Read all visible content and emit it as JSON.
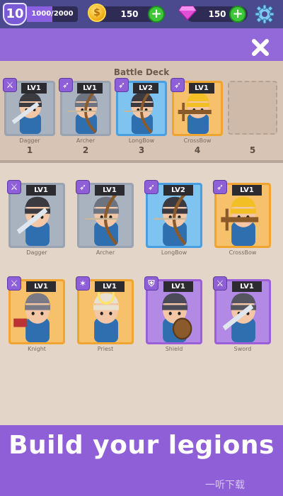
{
  "topbar": {
    "level": "10",
    "xp_text": "1000/2000",
    "xp_fraction": 0.5,
    "coins": "150",
    "gems": "150"
  },
  "deck": {
    "title": "Battle Deck",
    "slots": [
      {
        "number": "1",
        "lv": "LV1",
        "name": "Dagger",
        "rarity": "grey"
      },
      {
        "number": "2",
        "lv": "LV1",
        "name": "Archer",
        "rarity": "grey"
      },
      {
        "number": "3",
        "lv": "LV2",
        "name": "LongBow",
        "rarity": "blue"
      },
      {
        "number": "4",
        "lv": "LV1",
        "name": "CrossBow",
        "rarity": "orange"
      },
      {
        "number": "5"
      }
    ]
  },
  "collection": {
    "cards": [
      {
        "lv": "LV1",
        "name": "Dagger",
        "rarity": "grey"
      },
      {
        "lv": "LV1",
        "name": "Archer",
        "rarity": "grey"
      },
      {
        "lv": "LV2",
        "name": "LongBow",
        "rarity": "blue"
      },
      {
        "lv": "LV1",
        "name": "CrossBow",
        "rarity": "orange"
      },
      {
        "lv": "LV1",
        "name": "Knight",
        "rarity": "orange"
      },
      {
        "lv": "LV1",
        "name": "Priest",
        "rarity": "orange"
      },
      {
        "lv": "LV1",
        "name": "Shield",
        "rarity": "purple"
      },
      {
        "lv": "LV1",
        "name": "Sword",
        "rarity": "purple"
      }
    ]
  },
  "banner": {
    "text": "Build your legions"
  },
  "watermark": {
    "text": "一听下载"
  },
  "colors": {
    "topbar": "#4b4a8e",
    "accent_purple": "#9368d8",
    "deck_bg": "#d7c4b5",
    "collection_bg": "#e3d5c8",
    "plus_green": "#3fc63a",
    "coin_gold": "#f2b320",
    "gem_pink": "#e24fd8"
  },
  "icons": {
    "coin": "coin-icon",
    "gem": "gem-icon",
    "settings": "gear-icon",
    "close": "close-icon",
    "add": "plus-icon"
  }
}
